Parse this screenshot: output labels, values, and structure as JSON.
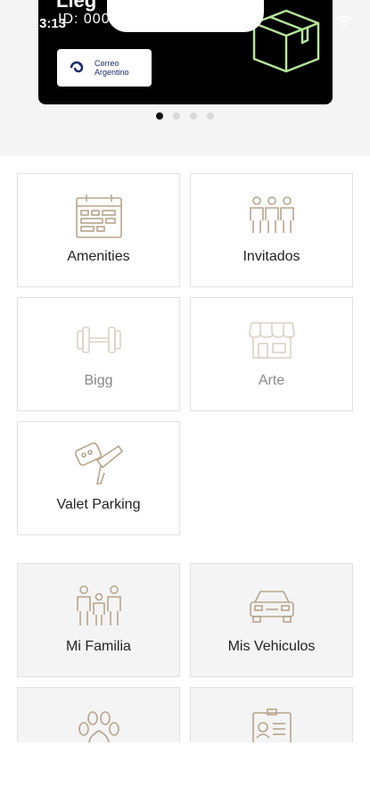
{
  "status": {
    "time": "3:13"
  },
  "banner": {
    "title": "Lleg",
    "id_text": "ID: 000",
    "logo_text_line1": "Correo",
    "logo_text_line2": "Argentino"
  },
  "carousel": {
    "pages": 4,
    "active": 0
  },
  "tiles": {
    "amenities": "Amenities",
    "invitados": "Invitados",
    "bigg": "Bigg",
    "arte": "Arte",
    "valet": "Valet Parking",
    "familia": "Mi Familia",
    "vehiculos": "Mis Vehiculos"
  },
  "colors": {
    "icon_stroke": "#b8a48a",
    "banner_bg": "#000000",
    "accent_green": "#b6e59a"
  }
}
